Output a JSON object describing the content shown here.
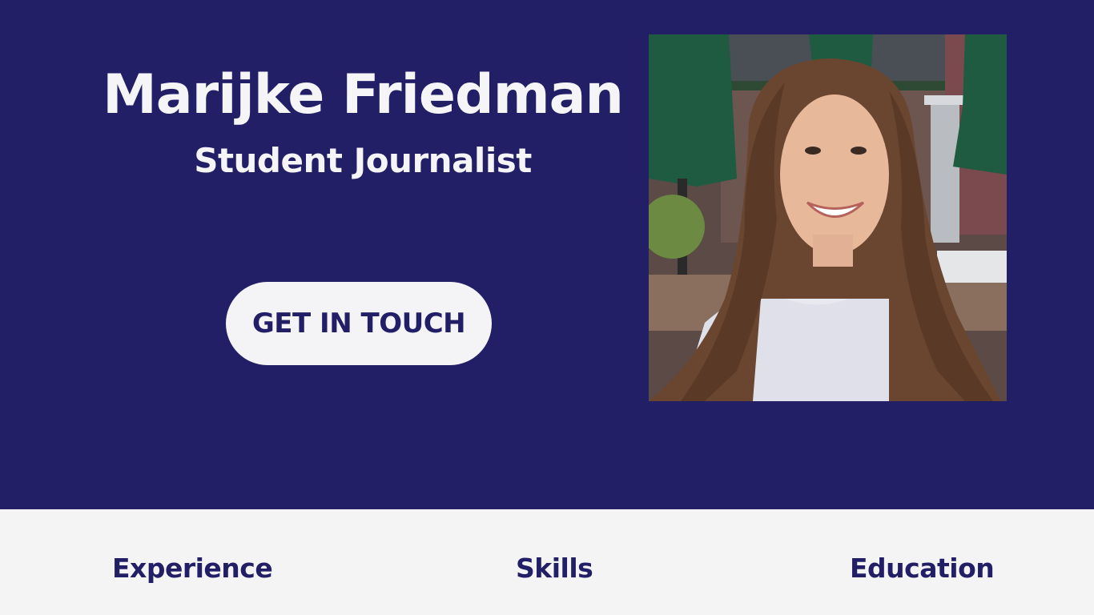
{
  "hero": {
    "name": "Marijke Friedman",
    "role": "Student Journalist",
    "cta_label": "GET IN TOUCH",
    "background_color": "#221f66",
    "text_color": "#f5f5f7"
  },
  "photo": {
    "alt": "Marijke Friedman"
  },
  "sections": {
    "experience": "Experience",
    "skills": "Skills",
    "education": "Education",
    "background_color": "#f4f4f5",
    "text_color": "#221f66"
  }
}
